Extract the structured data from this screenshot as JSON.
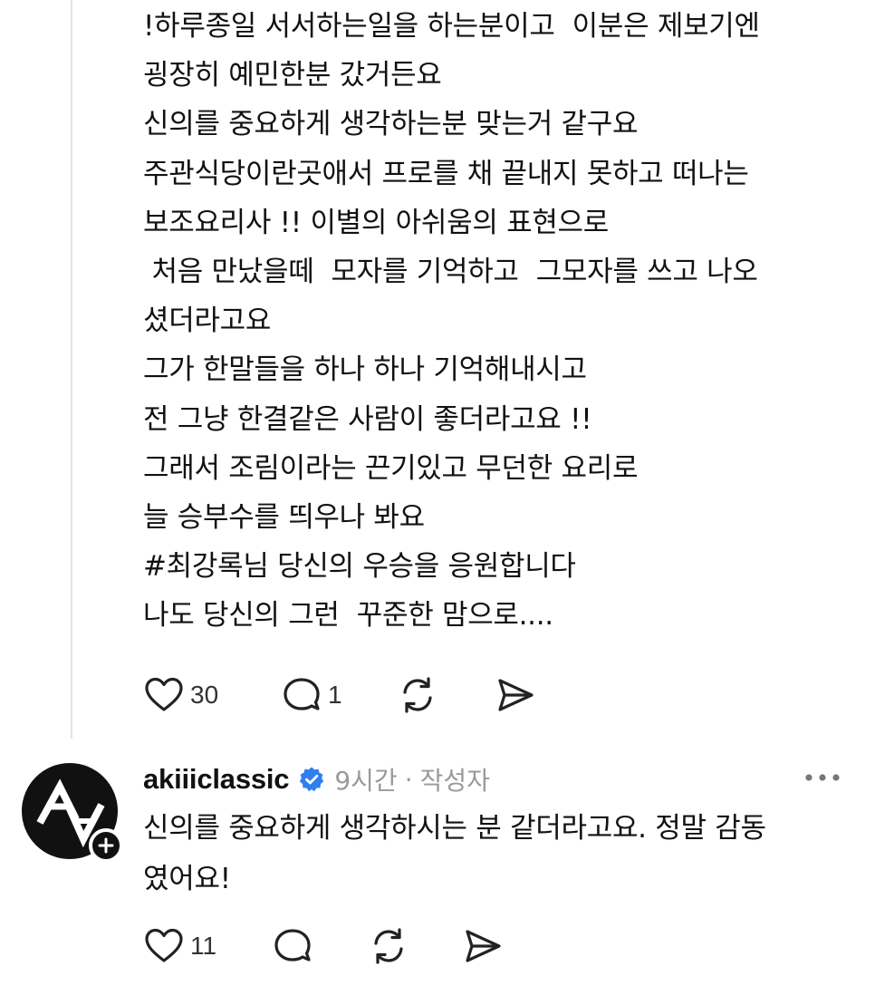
{
  "post": {
    "lines": [
      "!하루종일 서서하는일을 하는분이고  이분은 제보기엔",
      "굉장히 예민한분 갔거든요",
      "신의를 중요하게 생각하는분 맞는거 같구요",
      "주관식당이란곳애서 프로를 채 끝내지 못하고 떠나는",
      "보조요리사 !! 이별의 아쉬움의 표현으로",
      " 처음 만났을떼  모자를 기억하고  그모자를 쓰고 나오",
      "셨더라고요",
      "그가 한말들을 하나 하나 기억해내시고",
      "전 그냥 한결같은 사람이 좋더라고요 !!",
      "그래서 조림이라는 끈기있고 무던한 요리로",
      "늘 승부수를 띄우나 봐요",
      "#최강록님 당신의 우승을 응원합니다",
      "나도 당신의 그런  꾸준한 맘으로...."
    ],
    "actions": {
      "likes": "30",
      "replies": "1"
    }
  },
  "reply": {
    "username": "akiiiclassic",
    "time": "9시간",
    "separator": "·",
    "author_tag": "작성자",
    "lines": [
      "신의를 중요하게 생각하시는 분 같더라고요. 정말 감동",
      "였어요!"
    ],
    "actions": {
      "likes": "11"
    }
  },
  "icons": {
    "like": "heart-icon",
    "reply": "comment-bubble-icon",
    "repost": "repost-icon",
    "share": "send-icon",
    "more": "more-dots-icon",
    "verified": "verified-badge-icon",
    "follow": "plus-icon"
  },
  "colors": {
    "text": "#111111",
    "meta": "#9a9a9a",
    "verified": "#2f7ff0",
    "avatar_bg": "#111111"
  }
}
